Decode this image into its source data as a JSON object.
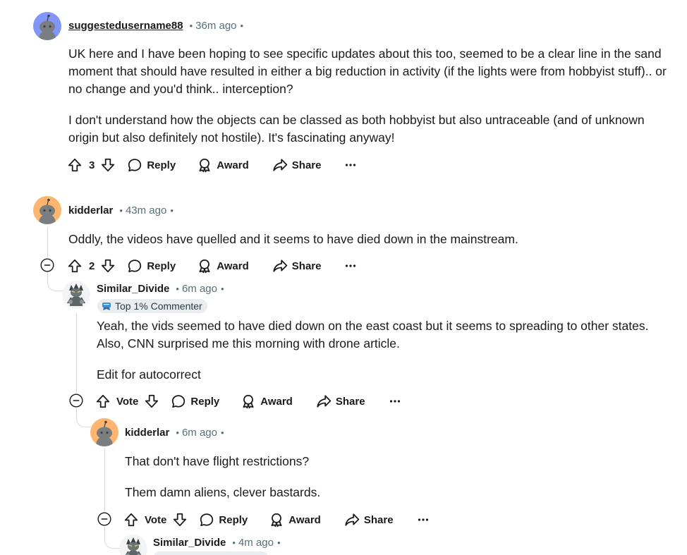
{
  "colors": {
    "text": "#1a1a1b",
    "meta": "#576f76",
    "thread_line": "#d6dadd",
    "avatar_blue": "#8296fa",
    "avatar_orange": "#ffb470",
    "flair_bg": "#eaedef"
  },
  "comments": [
    {
      "username": "suggestedusername88",
      "time": "36m ago",
      "avatar": "snoo-blue-icon",
      "paragraphs": [
        "UK here and I have been hoping to see specific updates about this too, seemed to be a clear line in the sand moment that should have resulted in either a big reduction in activity (if the lights were from hobbyist stuff).. or no change and you'd think.. interception?",
        "I don't understand how the objects can be classed as both hobbyist but also untraceable (and of unknown origin but also definitely not hostile). It's fascinating anyway!"
      ],
      "vote_label": "3",
      "reply_label": "Reply",
      "award_label": "Award",
      "share_label": "Share"
    },
    {
      "username": "kidderlar",
      "time": "43m ago",
      "avatar": "snoo-orange-icon",
      "paragraphs": [
        "Oddly, the videos have quelled and it seems to have died down in the mainstream."
      ],
      "vote_label": "2",
      "reply_label": "Reply",
      "award_label": "Award",
      "share_label": "Share"
    },
    {
      "username": "Similar_Divide",
      "time": "6m ago",
      "avatar": "custom-avatar-icon",
      "flair": "Top 1% Commenter",
      "paragraphs": [
        "Yeah, the vids seemed to have died down on the east coast but it seems to spreading to other states. Also, CNN surprised me this morning with drone article.",
        "Edit for autocorrect"
      ],
      "vote_label": "Vote",
      "reply_label": "Reply",
      "award_label": "Award",
      "share_label": "Share"
    },
    {
      "username": "kidderlar",
      "time": "6m ago",
      "avatar": "snoo-orange-icon",
      "paragraphs": [
        "That don't have flight restrictions?",
        "Them damn aliens, clever bastards."
      ],
      "vote_label": "Vote",
      "reply_label": "Reply",
      "award_label": "Award",
      "share_label": "Share"
    },
    {
      "username": "Similar_Divide",
      "time": "4m ago",
      "avatar": "custom-avatar-icon"
    }
  ]
}
